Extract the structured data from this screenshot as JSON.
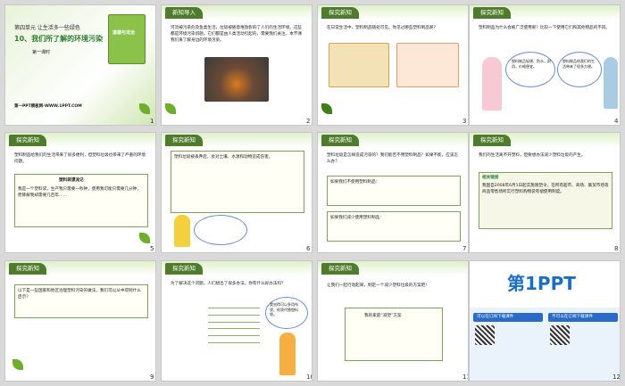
{
  "slides": [
    {
      "number": "1",
      "unit": "第四单元 让生活多一些绿色",
      "title": "10、我们所了解的环境污染",
      "period": "第一课时",
      "footer": "第一PPT模板网-WWW.1PPT.COM",
      "book_label": "道德与法治"
    },
    {
      "number": "2",
      "tag": "新知导入",
      "body": "河流被污染危及鱼类生活，垃圾被随意堆放影响了人们的生活环境。这些都是环境污染问题，它们都是由人类活动引起的，需要我们关注。本节课我们来了解身边的环境污染。"
    },
    {
      "number": "3",
      "tag": "探究新知",
      "body": "在日常生活中，塑料制品随处可见。你见过哪些塑料制品呢？"
    },
    {
      "number": "4",
      "tag": "探究新知",
      "body": "塑料制品为什么会被广泛使用呢？比较一下使用它们和其他物品的不同。",
      "bubble_left": "塑料制品轻便、防水、耐用，价格便宜。",
      "bubble_right": "塑料制品给我们的生活带来了很多方便。"
    },
    {
      "number": "5",
      "tag": "探究新知",
      "body": "塑料制品给我们的生活带来了很多便利，但塑料垃圾也带来了严重的环境问题。",
      "title": "塑料袋漂流记",
      "body2": "我是一个塑料袋，生产我只需要一秒钟，使用我可能只需要几分钟，而降解我却需要几百年……"
    },
    {
      "number": "6",
      "tag": "探究新知",
      "body": "塑料垃圾被丢弃后，会对土壤、水源和动物造成伤害。"
    },
    {
      "number": "7",
      "tag": "探究新知",
      "body": "塑料垃圾是怎样造成污染的？我们能否不用塑料制品？如果不能，应该怎么办？",
      "field1": "如果我们不使用塑料制品：",
      "field2": "如果我们减少使用塑料制品："
    },
    {
      "number": "8",
      "tag": "探究新知",
      "body": "我们的生活离不开塑料，但要想办法减少塑料垃圾的产生。",
      "subtitle": "相关链接",
      "body2": "我国自2008年6月1日起实施限塑令，在所有超市、商场、集贸市场等商品零售场所实行塑料购物袋有偿使用制度。"
    },
    {
      "number": "9",
      "tag": "探究新知",
      "body": "以下是一些国家和地区治理塑料污染的做法，我们可以从中得到什么启示？"
    },
    {
      "number": "10",
      "tag": "探究新知",
      "body": "为了解决这个问题，人们想出了很多办法。你有什么好办法吗？",
      "bubble": "我觉得可以多用布袋、纸袋代替塑料袋。"
    },
    {
      "number": "11",
      "tag": "探究新知",
      "body": "让我们一起行动起来，制定一个减少塑料垃圾的方案吧！",
      "plan": "我的家庭“减塑”方案"
    },
    {
      "number": "12",
      "logo": "第1PPT",
      "banner_left": "可以在订阅下载课件",
      "banner_right": "不可以在订阅下载课件"
    }
  ]
}
